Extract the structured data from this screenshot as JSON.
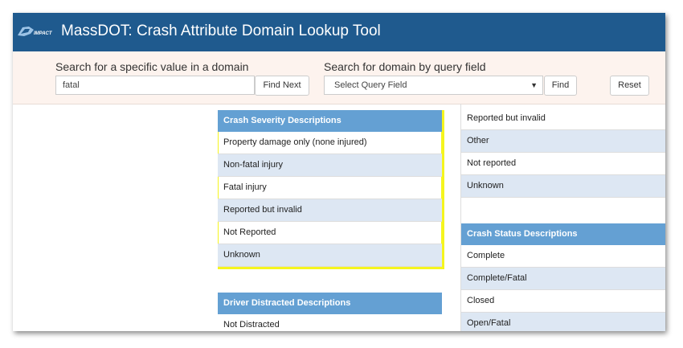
{
  "header": {
    "logo_text": "IMPACT",
    "title": "MassDOT: Crash Attribute Domain Lookup Tool"
  },
  "search": {
    "value_label": "Search for a specific value in a domain",
    "value_input": "fatal",
    "find_next_label": "Find Next",
    "field_label": "Search for domain by query field",
    "field_select": "Select Query Field",
    "find_label": "Find",
    "reset_label": "Reset"
  },
  "panels": {
    "severity": {
      "title": "Crash Severity Descriptions",
      "rows": [
        "Property damage only (none injured)",
        "Non-fatal injury",
        "Fatal injury",
        "Reported but invalid",
        "Not Reported",
        "Unknown"
      ]
    },
    "right_top": {
      "rows": [
        "Reported but invalid",
        "Other",
        "Not reported",
        "Unknown"
      ]
    },
    "status": {
      "title": "Crash Status Descriptions",
      "rows": [
        "Complete",
        "Complete/Fatal",
        "Closed",
        "Open/Fatal"
      ]
    },
    "distracted": {
      "title": "Driver Distracted Descriptions",
      "rows": [
        "Not Distracted"
      ]
    }
  },
  "colors": {
    "header": "#1f5a8e",
    "panel_header": "#64a0d3",
    "row_alt": "#dde7f3",
    "highlight": "#f5f51e",
    "search_bg": "#fdf3ee"
  }
}
